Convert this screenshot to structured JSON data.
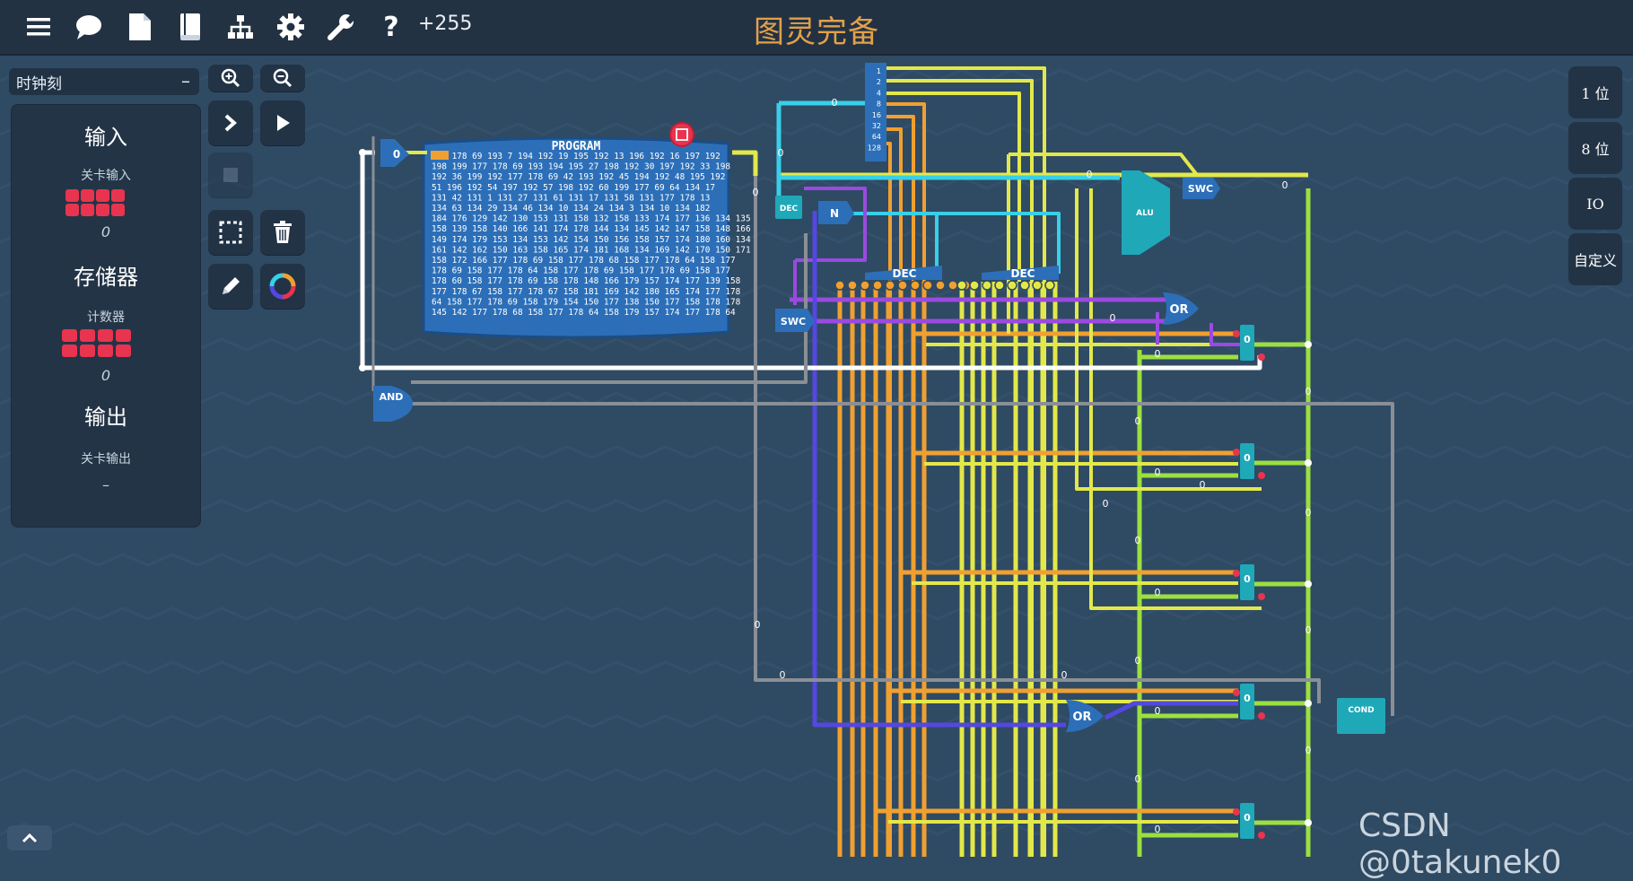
{
  "app": {
    "title": "图灵完备",
    "counter": "+255"
  },
  "toolbar": {
    "icons": [
      "menu-icon",
      "chat-icon",
      "file-icon",
      "book-icon",
      "hierarchy-icon",
      "gear-icon",
      "wrench-icon",
      "help-icon"
    ],
    "help_glyph": "?"
  },
  "level_select": {
    "value": "时钟刻",
    "dash": "–"
  },
  "level_panel": {
    "input_heading": "输入",
    "input_sub": "关卡输入",
    "input_value": "0",
    "storage_heading": "存储器",
    "storage_sub": "计数器",
    "storage_value": "0",
    "output_heading": "输出",
    "output_sub": "关卡输出",
    "output_value": "–"
  },
  "bit_buttons": [
    "1 位",
    "8 位",
    "IO",
    "自定义"
  ],
  "circuit": {
    "program_title": "PROGRAM",
    "program_lines": [
      "177 178 69 193  7  194 192 19 195 192 13 196 192 16 197 192",
      "198 199 177 178 69 193 194 195 27 198 192 30 197 192 33 198",
      "192 36 199 192 177 178 69 42 193 192 45 194 192 48 195 192",
      " 51 196 192 54 197 192 57 198 192 60 199 177 69 64 134 17",
      "131 42 131  1  131 27 131 61 131 17 131 58 131 177 178 13",
      "134 63 134 29 134 46 134 10 134 24 134  3  134 10 134 182",
      "184 176 129 142 130 153 131 158 132 158 133 174 177 136 134 135",
      "158 139 158 140 166 141 174 178 144 134 145 142 147 158 148 166",
      "149 174 179 153 134 153 142 154 150 156 158 157 174 180 160 134",
      "161 142 162 150 163 158 165 174 181 168 134 169 142 170 150 171",
      "158 172 166 177 178 69 158 177 178 68 158 177 178 64 158 177",
      "178 69 158 177 178 64 158 177 178 69 158 177 178 69 158 177",
      "178 60 158 177 178 69 158 178 148 166 179 157 174 177 139 158",
      "177 178 67 158 177 178 67 158 181 169 142 180 165 174 177 178",
      " 64 158 177 178 69 158 179 154 150 177 138 150 177 158 178 178",
      "145 142 177 178 68 158 177 178 64 158 179 157 174 177 178 64"
    ],
    "gate_and": "AND",
    "gate_or": "OR",
    "gate_swc": "SWC",
    "gate_dec": "DEC",
    "gate_n": "N",
    "gate_alu": "ALU",
    "gate_cond": "COND",
    "zero": "0",
    "bit_labels": [
      "1",
      "2",
      "4",
      "8",
      "16",
      "32",
      "64",
      "128"
    ]
  },
  "watermark": "CSDN @0takunek0",
  "colors": {
    "background": "#2f4a63",
    "topbar": "#233243",
    "title": "#e2a04a",
    "wire_yellow": "#e3e84a",
    "wire_orange": "#f0a030",
    "wire_green": "#9be040",
    "wire_cyan": "#38d0e8",
    "wire_purple": "#9a4ae0",
    "wire_blue": "#5448e0",
    "wire_white": "#ffffff",
    "wire_gray": "#8a8f96",
    "component_teal": "#1fa8b8",
    "led_red": "#e8344e"
  }
}
